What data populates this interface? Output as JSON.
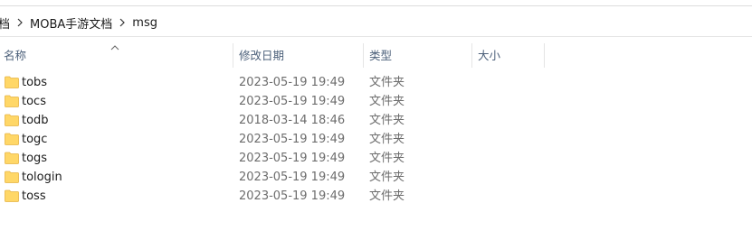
{
  "breadcrumb": {
    "partial": "档",
    "items": [
      "MOBA手游文档",
      "msg"
    ]
  },
  "columns": {
    "name": "名称",
    "modified": "修改日期",
    "type": "类型",
    "size": "大小"
  },
  "files": [
    {
      "name": "tobs",
      "modified": "2023-05-19 19:49",
      "type": "文件夹"
    },
    {
      "name": "tocs",
      "modified": "2023-05-19 19:49",
      "type": "文件夹"
    },
    {
      "name": "todb",
      "modified": "2018-03-14 18:46",
      "type": "文件夹"
    },
    {
      "name": "togc",
      "modified": "2023-05-19 19:49",
      "type": "文件夹"
    },
    {
      "name": "togs",
      "modified": "2023-05-19 19:49",
      "type": "文件夹"
    },
    {
      "name": "tologin",
      "modified": "2023-05-19 19:49",
      "type": "文件夹"
    },
    {
      "name": "toss",
      "modified": "2023-05-19 19:49",
      "type": "文件夹"
    }
  ],
  "colors": {
    "folder": "#ffd767",
    "folder_dark": "#e6b443",
    "header_text": "#4c607a",
    "meta_text": "#6d6d6d"
  },
  "icons": {
    "folder": "folder-icon",
    "separator": "chevron-right-icon",
    "sort": "sort-ascending-icon"
  }
}
